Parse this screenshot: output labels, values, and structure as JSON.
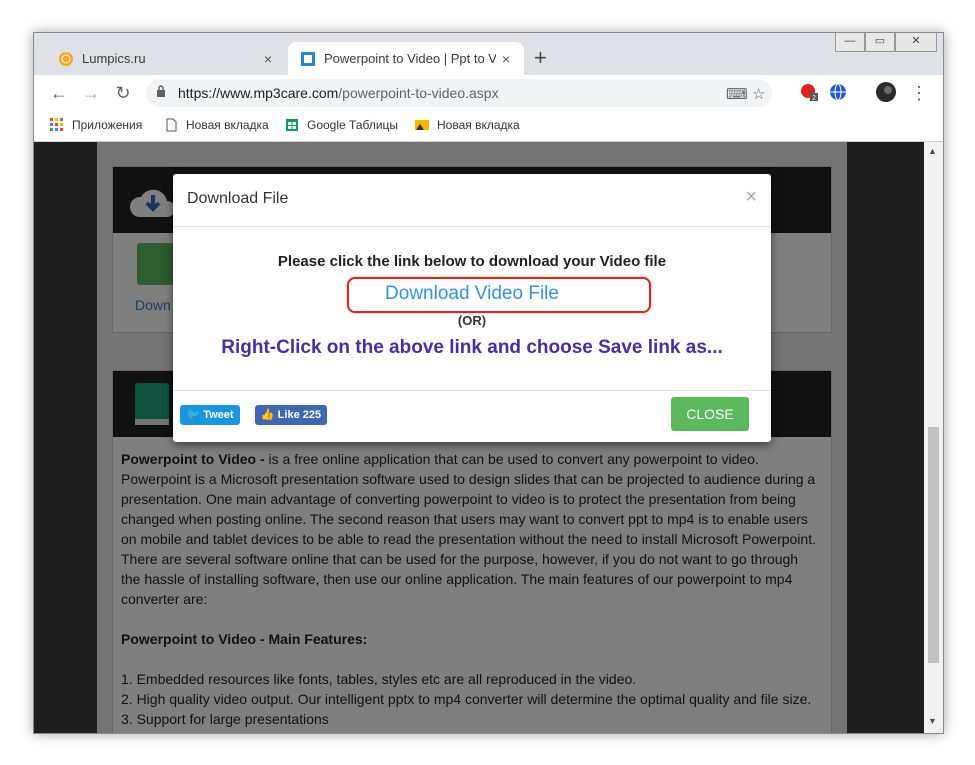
{
  "tabs": [
    {
      "title": "Lumpics.ru",
      "close": "×"
    },
    {
      "title": "Powerpoint to Video | Ppt to Vide",
      "close": "×"
    }
  ],
  "new_tab": "+",
  "window_controls": {
    "minimize": "—",
    "maximize": "▭",
    "close": "✕"
  },
  "toolbar": {
    "url_host": "https://www.mp3care.com",
    "url_path": "/powerpoint-to-video.aspx",
    "ext_badge": "2"
  },
  "bookmarks": [
    {
      "label": "Приложения",
      "icon": "apps-grid-icon"
    },
    {
      "label": "Новая вкладка",
      "icon": "page-icon"
    },
    {
      "label": "Google Таблицы",
      "icon": "sheets-icon"
    },
    {
      "label": "Новая вкладка",
      "icon": "image-icon"
    }
  ],
  "page": {
    "download_link_partial": "Down",
    "intro_bold": "Powerpoint to Video -",
    "intro_text": " is a free online application that can be used to convert any powerpoint to video. Powerpoint is a Microsoft presentation software used to design slides that can be projected to audience during a presentation. One main advantage of converting powerpoint to video is to protect the presentation from being changed when posting online. The second reason that users may want to convert ppt to mp4 is to enable users on mobile and tablet devices to be able to read the presentation without the need to install Microsoft Powerpoint. There are several software online that can be used for the purpose, however, if you do not want to go through the hassle of installing software, then use our online application. The main features of our powerpoint to mp4 converter are:",
    "features_heading": "Powerpoint to Video - Main Features:",
    "features": [
      "1. Embedded resources like fonts, tables, styles etc are all reproduced in the video.",
      "2. High quality video output. Our intelligent pptx to mp4 converter will determine the optimal quality and file size.",
      "3. Support for large presentations"
    ]
  },
  "modal": {
    "title": "Download File",
    "close_x": "×",
    "instruction": "Please click the link below to download your Video file",
    "download_link": "Download Video File",
    "or": "(OR)",
    "right_click": "Right-Click on the above link and choose Save link as...",
    "tweet": "Tweet",
    "like": "Like 225",
    "close_button": "CLOSE"
  },
  "colors": {
    "accent_green": "#5cb85c",
    "link_blue": "#3b8fd9",
    "highlight_red": "#d9261c",
    "purple": "#4a2d9e"
  }
}
